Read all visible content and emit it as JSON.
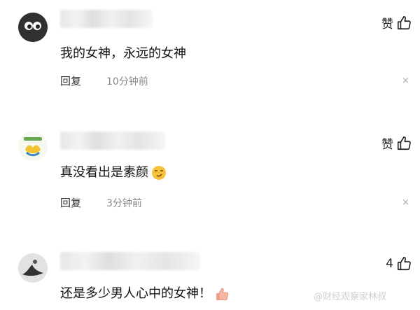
{
  "comments": [
    {
      "text": "我的女神，永远的女神",
      "reply_label": "回复",
      "time": "10分钟前",
      "like_label": "赞",
      "close": "×"
    },
    {
      "text": "真没看出是素颜",
      "reply_label": "回复",
      "time": "3分钟前",
      "like_label": "赞",
      "close": "×"
    },
    {
      "text": "还是多少男人心中的女神！",
      "like_count": "4"
    }
  ],
  "watermark": "@财经观察家林叔"
}
